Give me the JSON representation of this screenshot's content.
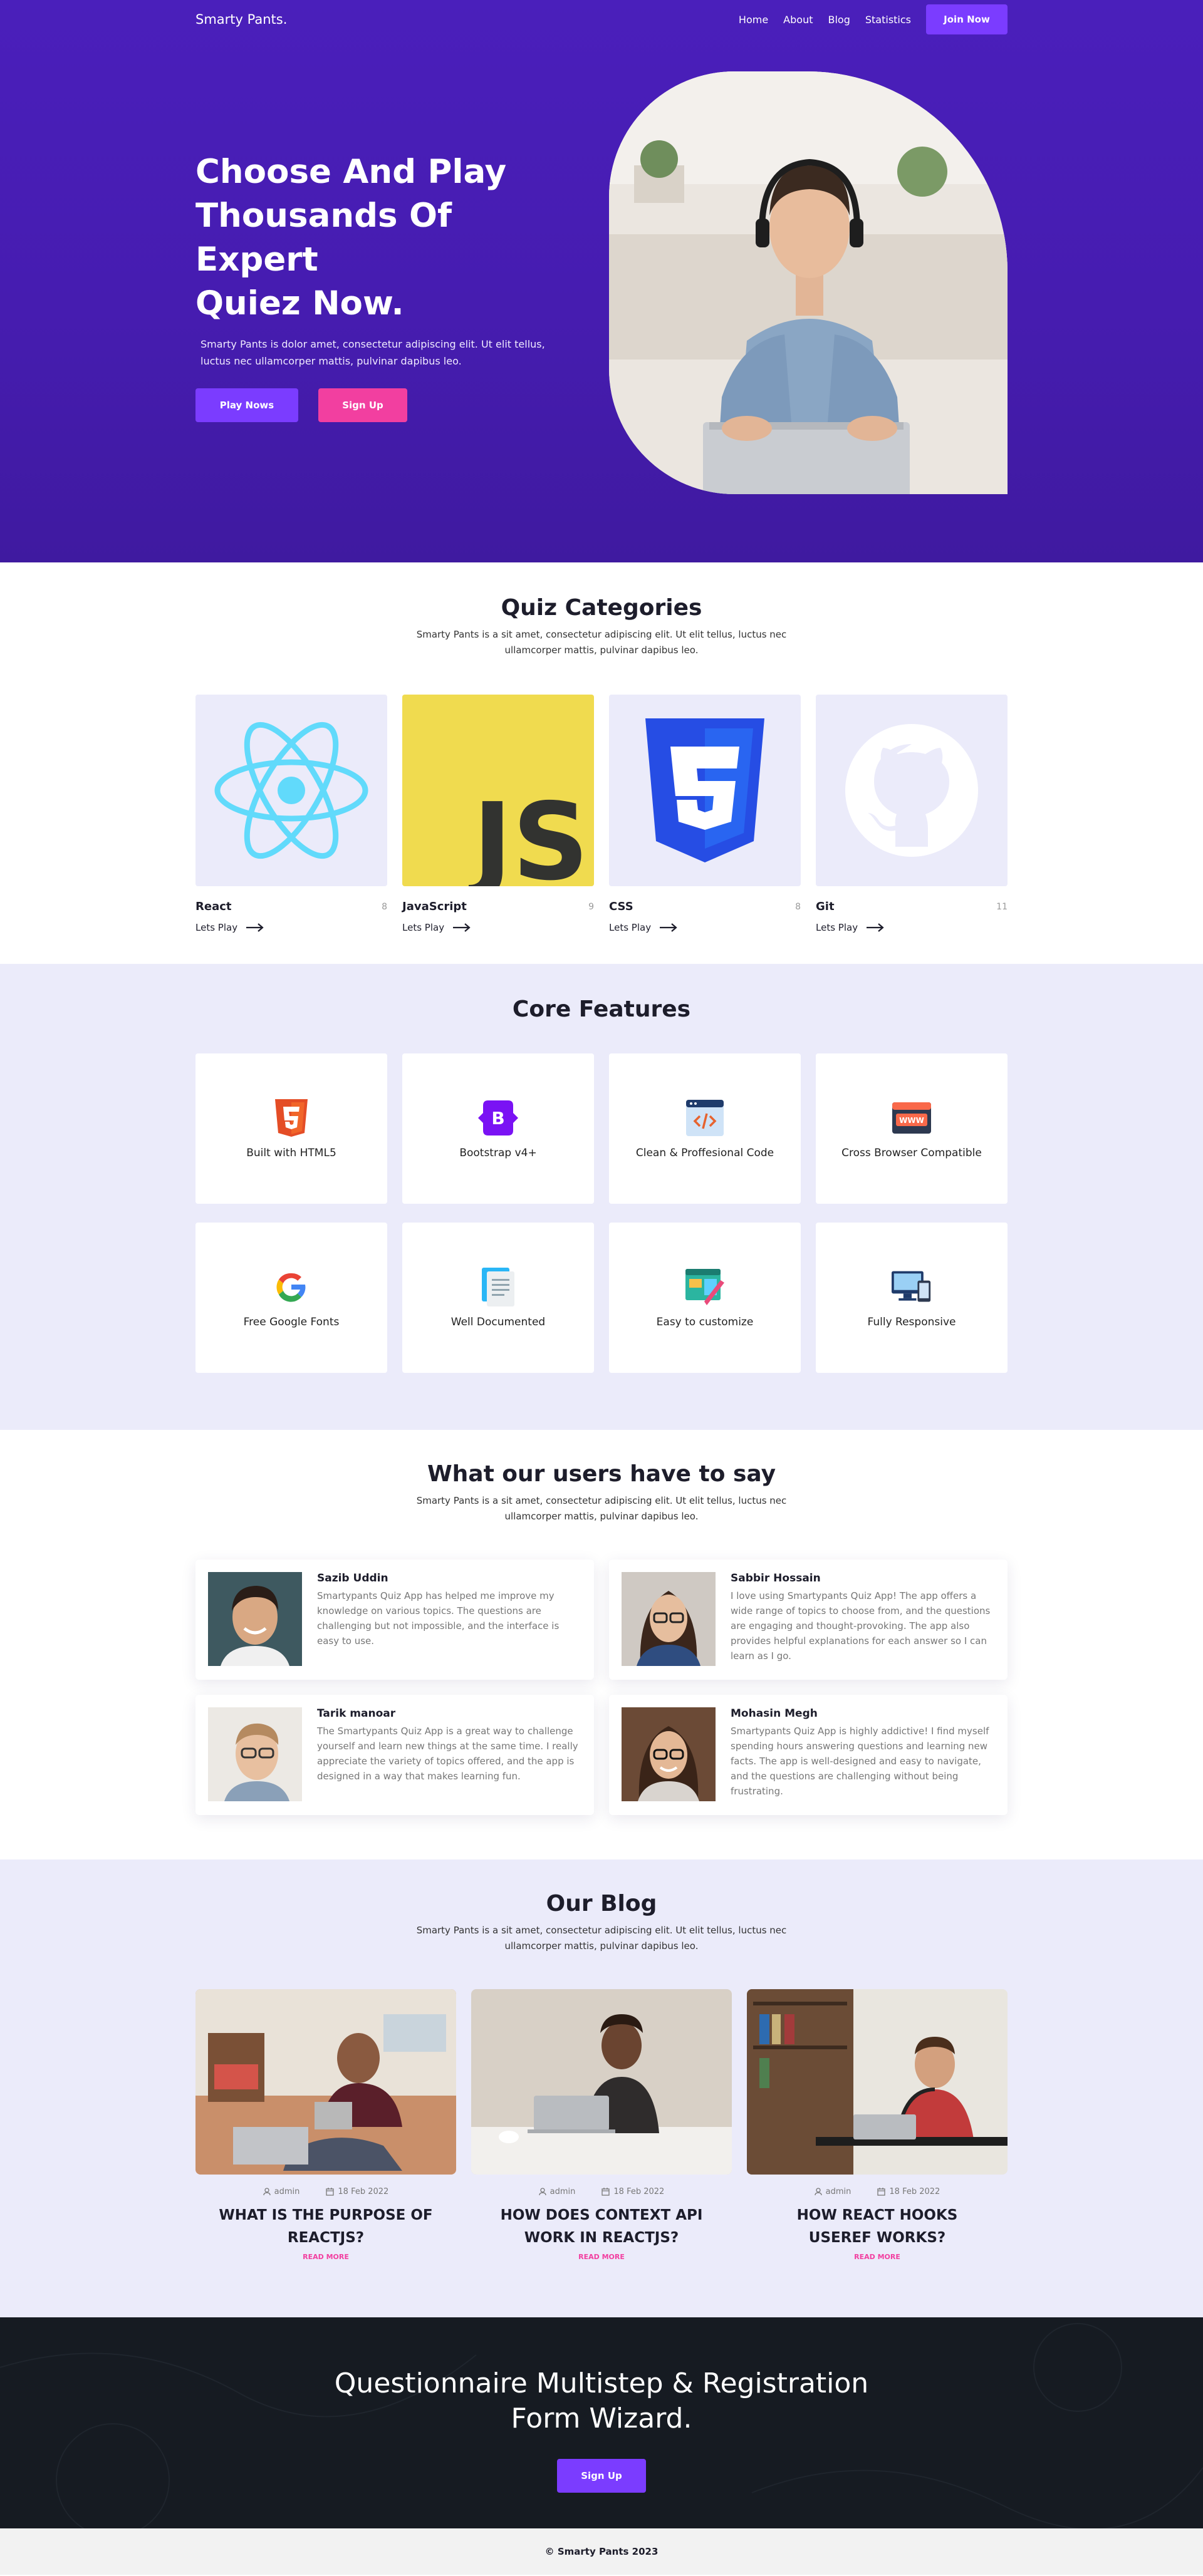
{
  "nav": {
    "brand": "Smarty Pants.",
    "links": [
      "Home",
      "About",
      "Blog",
      "Statistics"
    ],
    "join_label": "Join Now"
  },
  "hero": {
    "title_lines": [
      "Choose And Play",
      "Thousands Of Expert",
      "Quiez Now."
    ],
    "description": "Smarty Pants is dolor amet, consectetur adipiscing elit. Ut elit tellus, luctus nec ullamcorper mattis, pulvinar dapibus leo.",
    "play_label": "Play Nows",
    "signup_label": "Sign Up"
  },
  "categories": {
    "title": "Quiz Categories",
    "subtitle": "Smarty Pants is a sit amet, consectetur adipiscing elit. Ut elit tellus, luctus nec ullamcorper mattis, pulvinar dapibus leo.",
    "play_text": "Lets Play",
    "items": [
      {
        "name": "React",
        "count": "8",
        "icon": "react-logo-icon",
        "bg": "#ebebfa"
      },
      {
        "name": "JavaScript",
        "count": "9",
        "icon": "javascript-logo-icon",
        "bg": "#f0db4f"
      },
      {
        "name": "CSS",
        "count": "8",
        "icon": "css3-logo-icon",
        "bg": "#ebebfa"
      },
      {
        "name": "Git",
        "count": "11",
        "icon": "github-logo-icon",
        "bg": "#ebebfa"
      }
    ]
  },
  "features": {
    "title": "Core Features",
    "items": [
      {
        "label": "Built with HTML5",
        "icon": "html5-icon"
      },
      {
        "label": "Bootstrap v4+",
        "icon": "bootstrap-icon"
      },
      {
        "label": "Clean & Proffesional Code",
        "icon": "code-window-icon"
      },
      {
        "label": "Cross Browser Compatible",
        "icon": "browser-www-icon"
      },
      {
        "label": "Free Google Fonts",
        "icon": "google-icon"
      },
      {
        "label": "Well Documented",
        "icon": "document-icon"
      },
      {
        "label": "Easy to customize",
        "icon": "customize-icon"
      },
      {
        "label": "Fully Responsive",
        "icon": "responsive-devices-icon"
      }
    ]
  },
  "testimonials": {
    "title": "What our users have to say",
    "subtitle": "Smarty Pants is a sit amet, consectetur adipiscing elit. Ut elit tellus, luctus nec ullamcorper mattis, pulvinar dapibus leo.",
    "items": [
      {
        "name": "Sazib Uddin",
        "text": "Smartypants Quiz App has helped me improve my knowledge on various topics. The questions are challenging but not impossible, and the interface is easy to use."
      },
      {
        "name": "Sabbir Hossain",
        "text": "I love using Smartypants Quiz App! The app offers a wide range of topics to choose from, and the questions are engaging and thought-provoking. The app also provides helpful explanations for each answer so I can learn as I go."
      },
      {
        "name": "Tarik manoar",
        "text": "The Smartypants Quiz App is a great way to challenge yourself and learn new things at the same time. I really appreciate the variety of topics offered, and the app is designed in a way that makes learning fun."
      },
      {
        "name": "Mohasin Megh",
        "text": "Smartypants Quiz App is highly addictive! I find myself spending hours answering questions and learning new facts. The app is well-designed and easy to navigate, and the questions are challenging without being frustrating."
      }
    ]
  },
  "blog": {
    "title": "Our Blog",
    "subtitle": "Smarty Pants is a sit amet, consectetur adipiscing elit. Ut elit tellus, luctus nec ullamcorper mattis, pulvinar dapibus leo.",
    "read_more": "READ MORE",
    "posts": [
      {
        "author": "admin",
        "date": "18 Feb 2022",
        "title": "WHAT IS THE PURPOSE OF REACTJS?"
      },
      {
        "author": "admin",
        "date": "18 Feb 2022",
        "title": "HOW DOES CONTEXT API WORK IN REACTJS?"
      },
      {
        "author": "admin",
        "date": "18 Feb 2022",
        "title": "HOW REACT HOOKS USEREF WORKS?"
      }
    ]
  },
  "cta": {
    "title_lines": [
      "Questionnaire Multistep & Registration",
      "Form Wizard."
    ],
    "button": "Sign Up"
  },
  "footer": {
    "text": "© Smarty Pants 2023"
  },
  "colors": {
    "hero_bg": "#4a1fbb",
    "accent_purple": "#7b3cff",
    "accent_pink": "#f23fa0",
    "soft_bg": "#ebebfa",
    "dark_bg": "#161b22"
  }
}
